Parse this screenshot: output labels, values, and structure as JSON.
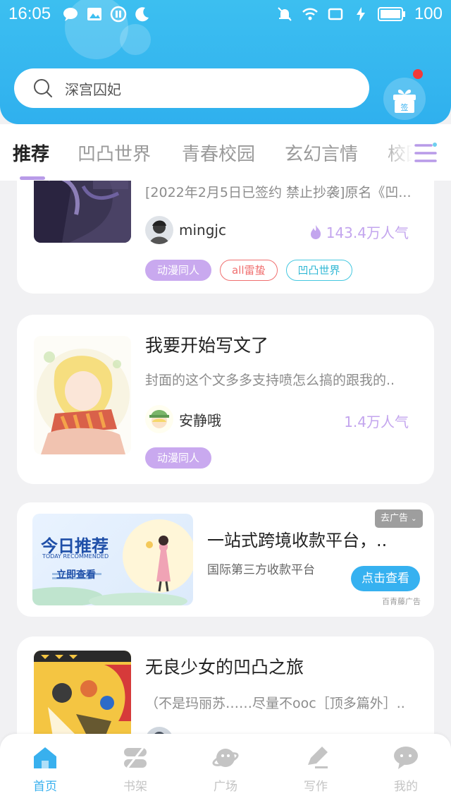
{
  "status_bar": {
    "time": "16:05",
    "battery": "100"
  },
  "search": {
    "placeholder": "深宫囚妃"
  },
  "tabs": [
    {
      "label": "推荐",
      "active": true
    },
    {
      "label": "凹凸世界"
    },
    {
      "label": "青春校园"
    },
    {
      "label": "玄幻言情"
    },
    {
      "label": "校园"
    }
  ],
  "books": [
    {
      "title": "",
      "description": "[2022年2月5日已签约 禁止抄袭]原名《凹...",
      "author": "mingjc",
      "popularity": "143.4万人气",
      "tags": [
        {
          "label": "动漫同人",
          "style": "purple"
        },
        {
          "label": "all雷蛰",
          "style": "red"
        },
        {
          "label": "凹凸世界",
          "style": "cyan"
        }
      ]
    },
    {
      "title": "我要开始写文了",
      "description": "封面的这个文多多支持喷怎么搞的跟我的..",
      "author": "安静哦",
      "popularity": "1.4万人气",
      "tags": [
        {
          "label": "动漫同人",
          "style": "purple"
        }
      ]
    },
    {
      "title": "无良少女的凹凸之旅",
      "description": "（不是玛丽苏……尽量不ooc［顶多篇外］..",
      "author": "",
      "popularity": "",
      "tags": []
    }
  ],
  "ad": {
    "banner_title": "今日推荐",
    "banner_en": "TODAY RECOMMENDED",
    "banner_cta": "立即查看",
    "title": "一站式跨境收款平台，..",
    "subtitle": "国际第三方收款平台",
    "button": "点击查看",
    "close_label": "去广告",
    "source": "百青藤广告"
  },
  "nav": [
    {
      "label": "首页",
      "icon": "home-icon",
      "active": true
    },
    {
      "label": "书架",
      "icon": "bookshelf-icon"
    },
    {
      "label": "广场",
      "icon": "planet-icon"
    },
    {
      "label": "写作",
      "icon": "pen-icon"
    },
    {
      "label": "我的",
      "icon": "chat-bubble-icon"
    }
  ],
  "colors": {
    "primary": "#36b1f0",
    "accent": "#c9a9ef",
    "notification": "#f23a3a"
  }
}
